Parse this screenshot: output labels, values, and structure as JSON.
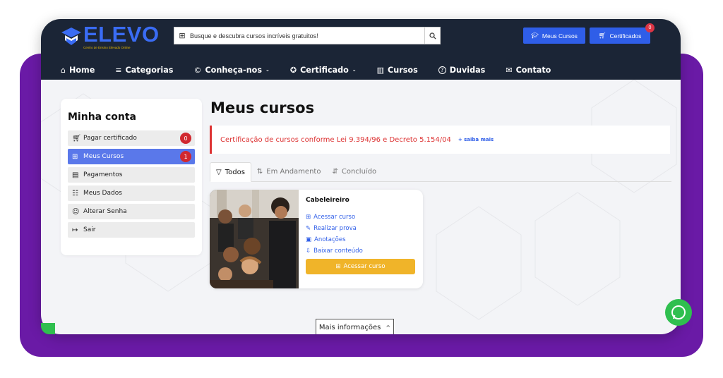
{
  "brand": {
    "name": "ELEVO",
    "tagline": "Centro de Ensino Elevado Online",
    "color": "#3a6cf4",
    "tagline_color": "#e5b700"
  },
  "search": {
    "placeholder": "Busque e descubra cursos incríveis gratuitos!",
    "icon": "gift-icon",
    "button_icon": "search-icon"
  },
  "header_buttons": {
    "my_courses": {
      "label": "Meus Cursos",
      "icon": "graduation-cap-icon"
    },
    "certificates": {
      "label": "Certificados",
      "icon": "cart-icon",
      "badge": "0"
    }
  },
  "nav": [
    {
      "label": "Home",
      "icon": "home-icon",
      "glyph": "⌂"
    },
    {
      "label": "Categorias",
      "icon": "menu-icon",
      "glyph": "≡"
    },
    {
      "label": "Conheça-nos",
      "icon": "copyright-icon",
      "glyph": "©",
      "dropdown": true
    },
    {
      "label": "Certificado",
      "icon": "badge-icon",
      "glyph": "✪",
      "dropdown": true
    },
    {
      "label": "Cursos",
      "icon": "books-icon",
      "glyph": "▥"
    },
    {
      "label": "Duvidas",
      "icon": "help-icon",
      "glyph": "?"
    },
    {
      "label": "Contato",
      "icon": "mail-icon",
      "glyph": "✉"
    }
  ],
  "sidebar": {
    "title": "Minha conta",
    "items": [
      {
        "label": "Pagar certificado",
        "icon": "cart-icon",
        "glyph": "🛒",
        "badge": "0"
      },
      {
        "label": "Meus Cursos",
        "icon": "gift-icon",
        "glyph": "⊞",
        "badge": "1",
        "active": true
      },
      {
        "label": "Pagamentos",
        "icon": "receipt-icon",
        "glyph": "▤"
      },
      {
        "label": "Meus Dados",
        "icon": "id-icon",
        "glyph": "☷"
      },
      {
        "label": "Alterar Senha",
        "icon": "users-icon",
        "glyph": "☺"
      },
      {
        "label": "Sair",
        "icon": "logout-icon",
        "glyph": "↦"
      }
    ]
  },
  "main": {
    "title": "Meus cursos",
    "alert": {
      "text": "Certificação de cursos conforme Lei 9.394/96 e Decreto 5.154/04",
      "link": "+ saiba mais",
      "color": "#d33333"
    },
    "tabs": [
      {
        "label": "Todos",
        "icon": "filter-icon",
        "glyph": "▽",
        "active": true
      },
      {
        "label": "Em Andamento",
        "icon": "sort-icon",
        "glyph": "⇅"
      },
      {
        "label": "Concluído",
        "icon": "sort-done-icon",
        "glyph": "⇵"
      }
    ],
    "course": {
      "title": "Cabeleireiro",
      "links": [
        {
          "label": "Acessar curso",
          "icon": "gift-icon",
          "glyph": "⊞"
        },
        {
          "label": "Realizar prova",
          "icon": "edit-icon",
          "glyph": "✎"
        },
        {
          "label": "Anotações",
          "icon": "notes-icon",
          "glyph": "▣"
        },
        {
          "label": "Baixar conteúdo",
          "icon": "download-icon",
          "glyph": "⇩"
        }
      ],
      "button": "Acessar curso",
      "button_color": "#f0b429"
    },
    "more_info": "Mais informações"
  },
  "colors": {
    "header": "#1b2536",
    "accent": "#2f5ee8",
    "frame": "#6a1aa6",
    "badge": "#d1282f"
  }
}
